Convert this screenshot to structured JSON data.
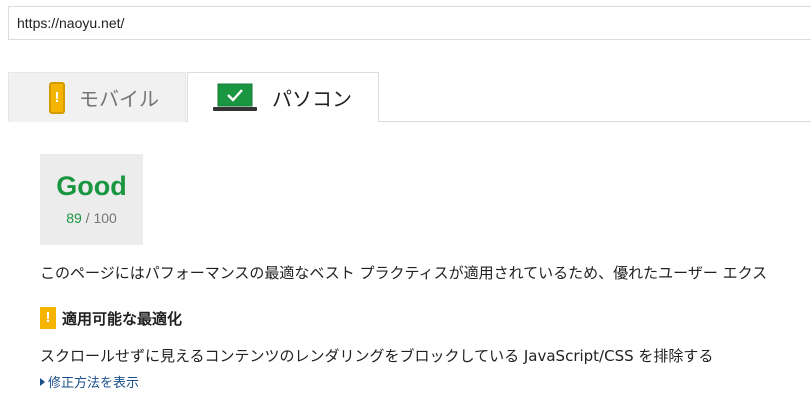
{
  "url_bar": {
    "value": "https://naoyu.net/"
  },
  "tabs": [
    {
      "label": "モバイル",
      "icon": "phone-warning-icon",
      "selected": false
    },
    {
      "label": "パソコン",
      "icon": "laptop-check-icon",
      "selected": true
    }
  ],
  "score": {
    "label": "Good",
    "value": "89",
    "separator": " / ",
    "max": "100"
  },
  "summary": "このページにはパフォーマンスの最適なベスト プラクティスが適用されているため、優れたユーザー エクス",
  "optimization": {
    "icon": "warning-icon",
    "icon_glyph": "!",
    "header": "適用可能な最適化",
    "rule": "スクロールせずに見えるコンテンツのレンダリングをブロックしている JavaScript/CSS を排除する",
    "fix_link": "修正方法を表示"
  },
  "colors": {
    "good": "#1a9641",
    "warning": "#f4b400",
    "link": "#1a4f8b"
  }
}
